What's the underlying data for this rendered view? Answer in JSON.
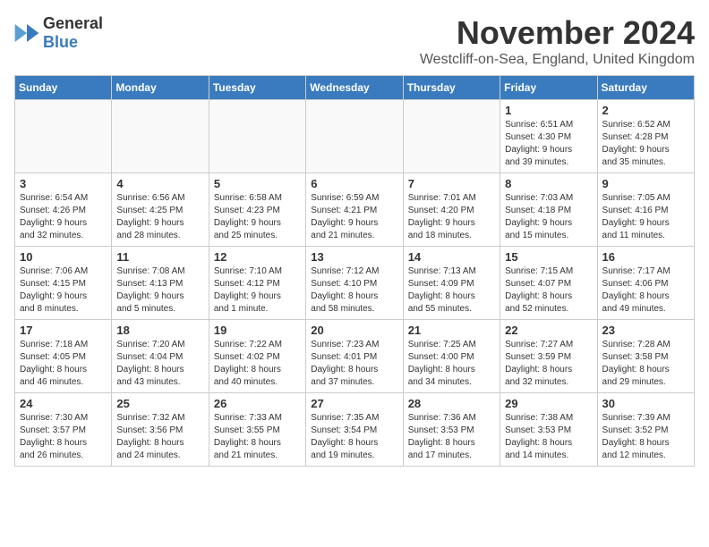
{
  "logo": {
    "general": "General",
    "blue": "Blue"
  },
  "title": {
    "month": "November 2024",
    "location": "Westcliff-on-Sea, England, United Kingdom"
  },
  "headers": [
    "Sunday",
    "Monday",
    "Tuesday",
    "Wednesday",
    "Thursday",
    "Friday",
    "Saturday"
  ],
  "weeks": [
    [
      {
        "day": "",
        "info": ""
      },
      {
        "day": "",
        "info": ""
      },
      {
        "day": "",
        "info": ""
      },
      {
        "day": "",
        "info": ""
      },
      {
        "day": "",
        "info": ""
      },
      {
        "day": "1",
        "info": "Sunrise: 6:51 AM\nSunset: 4:30 PM\nDaylight: 9 hours\nand 39 minutes."
      },
      {
        "day": "2",
        "info": "Sunrise: 6:52 AM\nSunset: 4:28 PM\nDaylight: 9 hours\nand 35 minutes."
      }
    ],
    [
      {
        "day": "3",
        "info": "Sunrise: 6:54 AM\nSunset: 4:26 PM\nDaylight: 9 hours\nand 32 minutes."
      },
      {
        "day": "4",
        "info": "Sunrise: 6:56 AM\nSunset: 4:25 PM\nDaylight: 9 hours\nand 28 minutes."
      },
      {
        "day": "5",
        "info": "Sunrise: 6:58 AM\nSunset: 4:23 PM\nDaylight: 9 hours\nand 25 minutes."
      },
      {
        "day": "6",
        "info": "Sunrise: 6:59 AM\nSunset: 4:21 PM\nDaylight: 9 hours\nand 21 minutes."
      },
      {
        "day": "7",
        "info": "Sunrise: 7:01 AM\nSunset: 4:20 PM\nDaylight: 9 hours\nand 18 minutes."
      },
      {
        "day": "8",
        "info": "Sunrise: 7:03 AM\nSunset: 4:18 PM\nDaylight: 9 hours\nand 15 minutes."
      },
      {
        "day": "9",
        "info": "Sunrise: 7:05 AM\nSunset: 4:16 PM\nDaylight: 9 hours\nand 11 minutes."
      }
    ],
    [
      {
        "day": "10",
        "info": "Sunrise: 7:06 AM\nSunset: 4:15 PM\nDaylight: 9 hours\nand 8 minutes."
      },
      {
        "day": "11",
        "info": "Sunrise: 7:08 AM\nSunset: 4:13 PM\nDaylight: 9 hours\nand 5 minutes."
      },
      {
        "day": "12",
        "info": "Sunrise: 7:10 AM\nSunset: 4:12 PM\nDaylight: 9 hours\nand 1 minute."
      },
      {
        "day": "13",
        "info": "Sunrise: 7:12 AM\nSunset: 4:10 PM\nDaylight: 8 hours\nand 58 minutes."
      },
      {
        "day": "14",
        "info": "Sunrise: 7:13 AM\nSunset: 4:09 PM\nDaylight: 8 hours\nand 55 minutes."
      },
      {
        "day": "15",
        "info": "Sunrise: 7:15 AM\nSunset: 4:07 PM\nDaylight: 8 hours\nand 52 minutes."
      },
      {
        "day": "16",
        "info": "Sunrise: 7:17 AM\nSunset: 4:06 PM\nDaylight: 8 hours\nand 49 minutes."
      }
    ],
    [
      {
        "day": "17",
        "info": "Sunrise: 7:18 AM\nSunset: 4:05 PM\nDaylight: 8 hours\nand 46 minutes."
      },
      {
        "day": "18",
        "info": "Sunrise: 7:20 AM\nSunset: 4:04 PM\nDaylight: 8 hours\nand 43 minutes."
      },
      {
        "day": "19",
        "info": "Sunrise: 7:22 AM\nSunset: 4:02 PM\nDaylight: 8 hours\nand 40 minutes."
      },
      {
        "day": "20",
        "info": "Sunrise: 7:23 AM\nSunset: 4:01 PM\nDaylight: 8 hours\nand 37 minutes."
      },
      {
        "day": "21",
        "info": "Sunrise: 7:25 AM\nSunset: 4:00 PM\nDaylight: 8 hours\nand 34 minutes."
      },
      {
        "day": "22",
        "info": "Sunrise: 7:27 AM\nSunset: 3:59 PM\nDaylight: 8 hours\nand 32 minutes."
      },
      {
        "day": "23",
        "info": "Sunrise: 7:28 AM\nSunset: 3:58 PM\nDaylight: 8 hours\nand 29 minutes."
      }
    ],
    [
      {
        "day": "24",
        "info": "Sunrise: 7:30 AM\nSunset: 3:57 PM\nDaylight: 8 hours\nand 26 minutes."
      },
      {
        "day": "25",
        "info": "Sunrise: 7:32 AM\nSunset: 3:56 PM\nDaylight: 8 hours\nand 24 minutes."
      },
      {
        "day": "26",
        "info": "Sunrise: 7:33 AM\nSunset: 3:55 PM\nDaylight: 8 hours\nand 21 minutes."
      },
      {
        "day": "27",
        "info": "Sunrise: 7:35 AM\nSunset: 3:54 PM\nDaylight: 8 hours\nand 19 minutes."
      },
      {
        "day": "28",
        "info": "Sunrise: 7:36 AM\nSunset: 3:53 PM\nDaylight: 8 hours\nand 17 minutes."
      },
      {
        "day": "29",
        "info": "Sunrise: 7:38 AM\nSunset: 3:53 PM\nDaylight: 8 hours\nand 14 minutes."
      },
      {
        "day": "30",
        "info": "Sunrise: 7:39 AM\nSunset: 3:52 PM\nDaylight: 8 hours\nand 12 minutes."
      }
    ]
  ]
}
